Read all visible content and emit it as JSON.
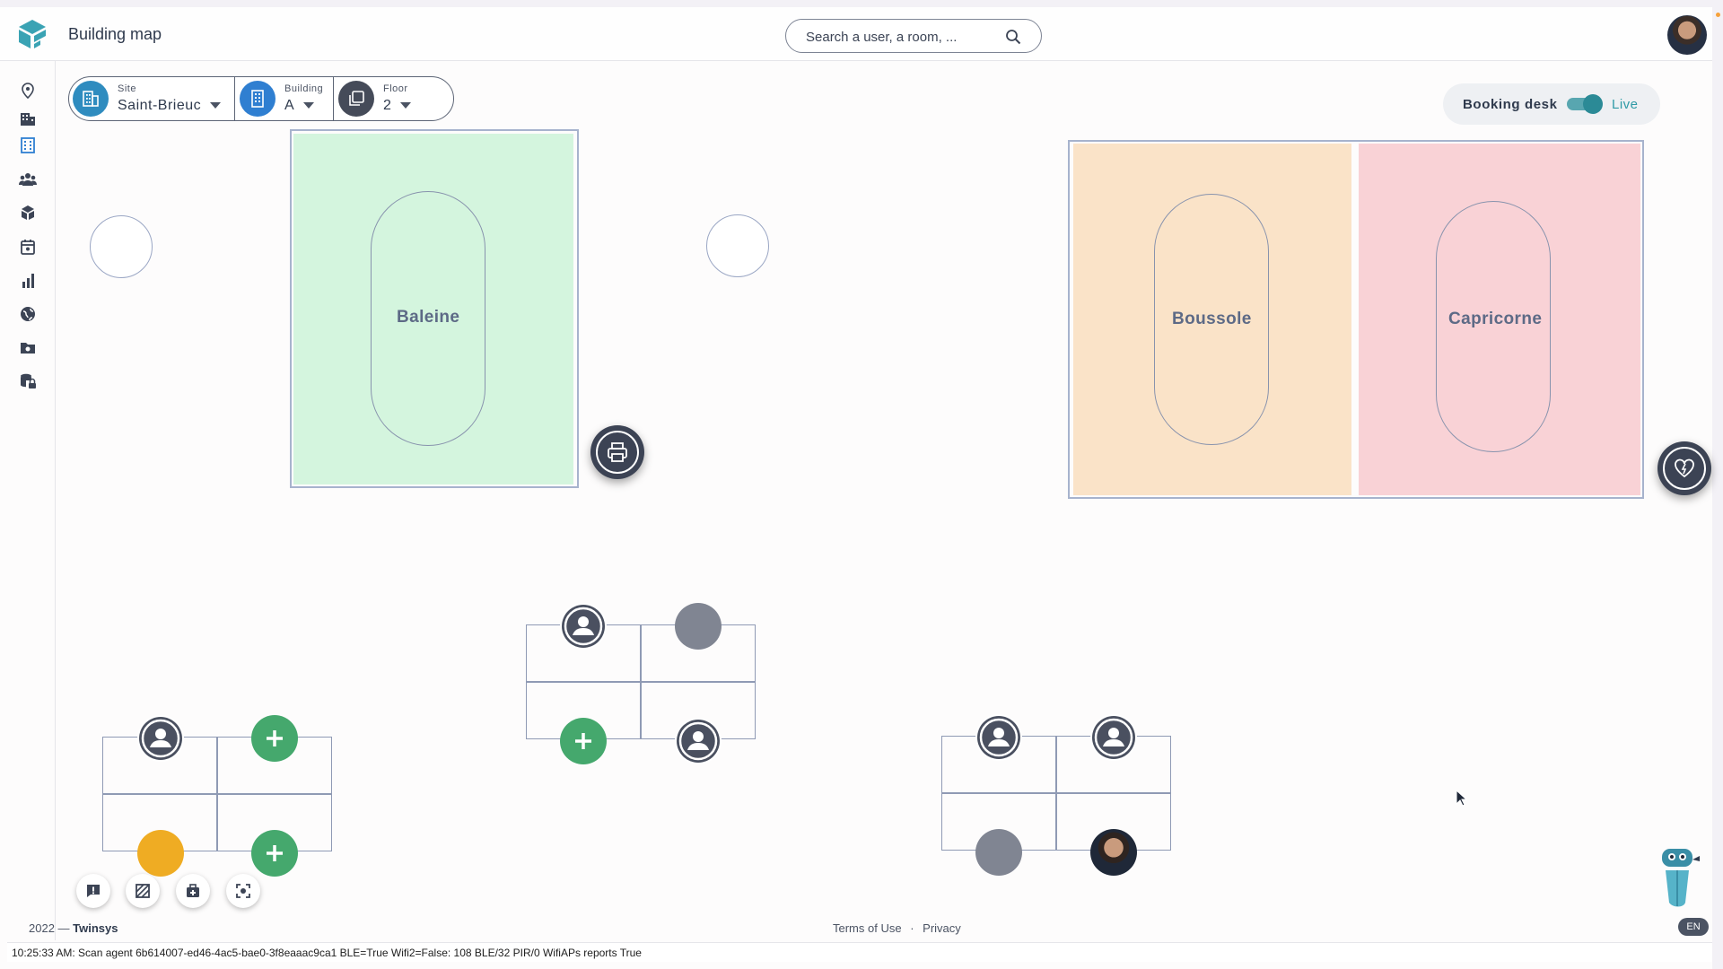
{
  "header": {
    "title": "Building map",
    "search_placeholder": "Search a user, a room, ...",
    "search_icon": "search-icon"
  },
  "sidebar": {
    "items": [
      {
        "icon": "location-pin-icon"
      },
      {
        "icon": "buildings-icon"
      },
      {
        "icon": "floor-plan-icon"
      },
      {
        "icon": "people-icon"
      },
      {
        "icon": "boxes-icon"
      },
      {
        "icon": "calendar-icon"
      },
      {
        "icon": "chart-icon"
      },
      {
        "icon": "globe-icon"
      },
      {
        "icon": "camera-folder-icon"
      },
      {
        "icon": "database-lock-icon"
      }
    ]
  },
  "filters": {
    "site": {
      "label": "Site",
      "value": "Saint-Brieuc"
    },
    "building": {
      "label": "Building",
      "value": "A"
    },
    "floor": {
      "label": "Floor",
      "value": "2"
    }
  },
  "booking": {
    "label": "Booking desk",
    "live": "Live",
    "enabled": true
  },
  "rooms": [
    {
      "name": "Baleine",
      "color": "#d4f5de"
    },
    {
      "name": "Boussole",
      "color": "#fae3c8"
    },
    {
      "name": "Capricorne",
      "color": "#f9d2d6"
    }
  ],
  "colors": {
    "accent": "#2b8a96",
    "add_seat": "#45a86d",
    "occupied_seat": "#808592",
    "pending_seat": "#efac23",
    "logo": "#3aa3b4"
  },
  "footer": {
    "year_company_prefix": "2022 — ",
    "company": "Twinsys",
    "terms": "Terms of Use",
    "separator": "·",
    "privacy": "Privacy",
    "language": "EN"
  },
  "status_bar": {
    "text": "10:25:33 AM: Scan agent 6b614007-ed46-4ac5-bae0-3f8eaaac9ca1 BLE=True Wifi2=False: 108 BLE/32 PIR/0 WifiAPs reports True"
  }
}
